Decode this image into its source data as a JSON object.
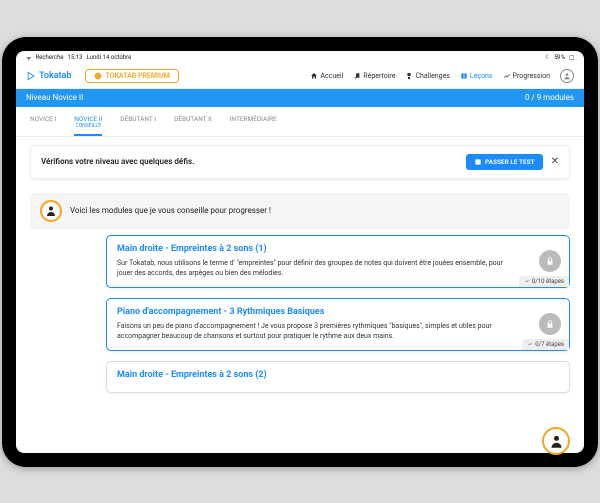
{
  "statusbar": {
    "search": "Recherche",
    "time": "15:13",
    "date": "Lundi 14 octobre",
    "battery": "59 %"
  },
  "logo": "Tokatab",
  "premium_label": "TOKATAB PREMIUM",
  "nav": {
    "accueil": "Accueil",
    "repertoire": "Répertoire",
    "challenges": "Challenges",
    "lecons": "Leçons",
    "progression": "Progression"
  },
  "levelbar": {
    "title": "Niveau Novice II",
    "progress": "0 / 9 modules"
  },
  "tabs": {
    "novice1": "NOVICE I",
    "novice2": "NOVICE II",
    "novice2_sub": "CONSEILLÉ",
    "debutant1": "DÉBUTANT I",
    "debutant2": "DÉBUTANT II",
    "intermediaire": "INTERMÉDIAIRE"
  },
  "verify": {
    "text": "Vérifions votre niveau avec quelques défis.",
    "button": "PASSER LE TEST"
  },
  "advice": "Voici les modules que je vous conseille pour progresser !",
  "modules": [
    {
      "title": "Main droite - Empreintes à 2 sons (1)",
      "desc": "Sur Tokatab, nous utilisons le terme d' \"empreintes\" pour définir des groupes de notes qui doivent être jouées ensemble, pour jouer des accords, des arpèges ou bien des mélodies.",
      "steps": "0/10 étapes",
      "locked": true
    },
    {
      "title": "Piano d'accompagnement - 3 Rythmiques Basiques",
      "desc": "Faisons un peu de piano d'accompagnement ! Je vous propose 3 premières rythmiques \"basiques\", simples et utiles pour accompagner beaucoup de chansons et surtout pour pratiquer le rythme aux deux mains.",
      "steps": "0/7 étapes",
      "locked": true
    },
    {
      "title": "Main droite - Empreintes à 2 sons (2)",
      "desc": "",
      "steps": "",
      "locked": false
    }
  ]
}
